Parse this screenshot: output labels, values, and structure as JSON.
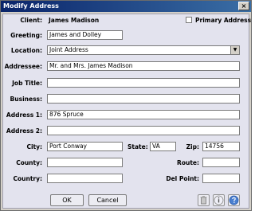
{
  "window": {
    "title": "Modify Address",
    "close_glyph": "×"
  },
  "client": {
    "label": "Client:",
    "value": "James Madison"
  },
  "primary_address": {
    "label": "Primary Address",
    "checked": false
  },
  "greeting": {
    "label": "Greeting:",
    "value": "James and Dolley"
  },
  "location": {
    "label": "Location:",
    "value": "Joint Address"
  },
  "addressee": {
    "label": "Addressee:",
    "value": "Mr. and Mrs. James Madison"
  },
  "job_title": {
    "label": "Job Title:",
    "value": ""
  },
  "business": {
    "label": "Business:",
    "value": ""
  },
  "address1": {
    "label": "Address 1:",
    "value": "876 Spruce"
  },
  "address2": {
    "label": "Address 2:",
    "value": ""
  },
  "city": {
    "label": "City:",
    "value": "Port Conway"
  },
  "state": {
    "label": "State:",
    "value": "VA"
  },
  "zip": {
    "label": "Zip:",
    "value": "14756"
  },
  "county": {
    "label": "County:",
    "value": ""
  },
  "route": {
    "label": "Route:",
    "value": ""
  },
  "country": {
    "label": "Country:",
    "value": ""
  },
  "del_point": {
    "label": "Del Point:",
    "value": ""
  },
  "buttons": {
    "ok": "OK",
    "cancel": "Cancel"
  },
  "icons": {
    "delete": "trash-icon",
    "info": "info-icon",
    "help": "help-icon"
  }
}
